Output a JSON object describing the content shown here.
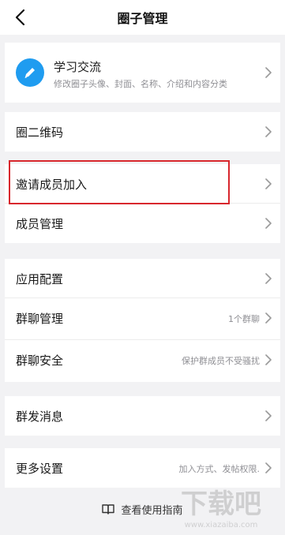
{
  "nav": {
    "title": "圈子管理",
    "back_icon": "chevron-left-icon"
  },
  "profile": {
    "name": "学习交流",
    "description": "修改圈子头像、封面、名称、介绍和内容分类",
    "avatar_icon": "pencil-icon",
    "avatar_color": "#1f9cf0"
  },
  "group_qr": {
    "label": "圈二维码"
  },
  "members": {
    "invite_label": "邀请成员加入",
    "manage_label": "成员管理"
  },
  "apps": {
    "config_label": "应用配置",
    "group_chat_label": "群聊管理",
    "group_chat_value": "1个群聊",
    "chat_security_label": "群聊安全",
    "chat_security_value": "保护群成员不受骚扰"
  },
  "broadcast": {
    "label": "群发消息"
  },
  "more": {
    "label": "更多设置",
    "value": "加入方式、发帖权限."
  },
  "guide": {
    "label": "查看使用指南",
    "icon": "book-icon"
  },
  "highlight_color": "#d8272d",
  "watermark": {
    "text": "下载吧",
    "url": "www.xiazaiba.com"
  }
}
